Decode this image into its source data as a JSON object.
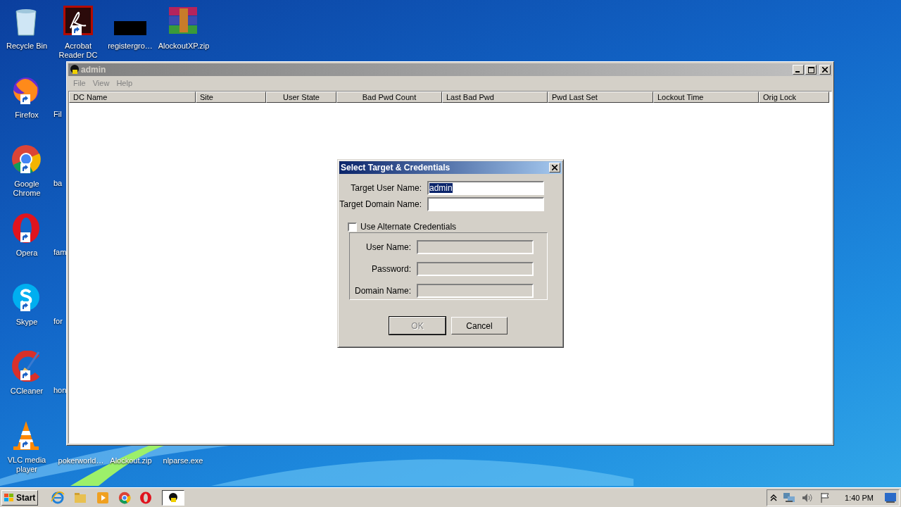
{
  "desktop": {
    "icons": [
      {
        "label": "Recycle Bin",
        "shortcut": false
      },
      {
        "label": "Acrobat Reader DC",
        "shortcut": true
      },
      {
        "label": "registergro…",
        "shortcut": false
      },
      {
        "label": "AlockoutXP.zip",
        "shortcut": false
      },
      {
        "label": "Firefox",
        "shortcut": true
      },
      {
        "label": "Fil"
      },
      {
        "label": "Google Chrome",
        "shortcut": true
      },
      {
        "label": "ba"
      },
      {
        "label": "Opera",
        "shortcut": true
      },
      {
        "label": "fam"
      },
      {
        "label": "Skype",
        "shortcut": true
      },
      {
        "label": "for"
      },
      {
        "label": "CCleaner",
        "shortcut": true
      },
      {
        "label": "hon"
      },
      {
        "label": "VLC media player",
        "shortcut": true
      },
      {
        "label": "pokerworld…"
      },
      {
        "label": "Alockout.zip"
      },
      {
        "label": "nlparse.exe"
      }
    ]
  },
  "window": {
    "title": "admin",
    "menu": [
      "File",
      "View",
      "Help"
    ],
    "columns": [
      "DC Name",
      "Site",
      "User State",
      "Bad Pwd Count",
      "Last Bad Pwd",
      "Pwd Last Set",
      "Lockout Time",
      "Orig Lock"
    ]
  },
  "dialog": {
    "title": "Select Target & Credentials",
    "fields": [
      {
        "label": "Target User Name:",
        "value": "admin",
        "highlighted": true
      },
      {
        "label": "Target Domain Name:"
      }
    ],
    "alternate": {
      "label": "Use Alternate Credentials",
      "checked": false,
      "fields": [
        {
          "label": "User Name:",
          "disabled": true
        },
        {
          "label": "Password:",
          "disabled": true
        },
        {
          "label": "Domain Name:",
          "disabled": true
        }
      ]
    },
    "buttons": [
      {
        "label": "OK",
        "disabled": true
      },
      {
        "label": "Cancel",
        "disabled": false
      }
    ]
  },
  "taskbar": {
    "start": "Start",
    "clock": "1:40 PM"
  }
}
